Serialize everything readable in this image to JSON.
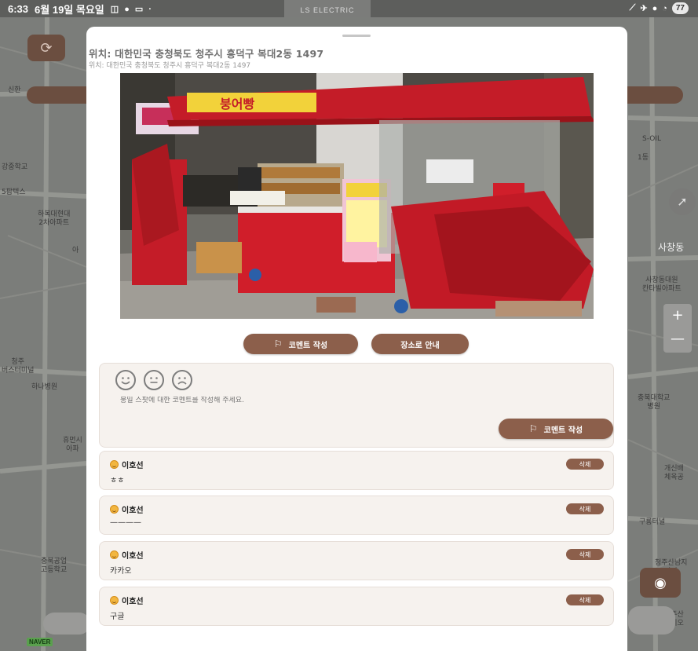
{
  "status_bar": {
    "time": "6:33",
    "date": "6월 19일 목요일",
    "battery": "77",
    "sign_text": "LS ELECTRIC"
  },
  "map": {
    "labels": [
      {
        "text": "신한",
        "id": "l1"
      },
      {
        "text": "강중학교",
        "id": "l2"
      },
      {
        "text": "5팝텍스",
        "id": "l3"
      },
      {
        "text": "하복대현대\n2차아파트",
        "id": "l4"
      },
      {
        "text": "아",
        "id": "l5"
      },
      {
        "text": "청주\n버스터미널",
        "id": "l6"
      },
      {
        "text": "하나병원",
        "id": "l7"
      },
      {
        "text": "휴먼시\n아파",
        "id": "l8"
      },
      {
        "text": "충북공업\n고등학교",
        "id": "l9"
      },
      {
        "text": "S-OIL",
        "id": "r1"
      },
      {
        "text": "1동",
        "id": "r2"
      },
      {
        "text": "사창동",
        "id": "r3"
      },
      {
        "text": "사창동대원\n칸타빌아파트",
        "id": "r4"
      },
      {
        "text": "충북대학교\n병원",
        "id": "r5"
      },
      {
        "text": "개신배\n체육공",
        "id": "r6"
      },
      {
        "text": "구룡터널",
        "id": "r7"
      },
      {
        "text": "청주산남지\n아파",
        "id": "r8"
      },
      {
        "text": "정주산\n르지오",
        "id": "r9"
      }
    ],
    "naver_logo": "NAVER",
    "zoom_in": "+",
    "zoom_out": "—"
  },
  "sheet": {
    "location_title": "위치: 대한민국 충청북도 청주시 흥덕구 복대2동 1497",
    "location_sub": "위치: 대한민국 충청북도 청주시 흥덕구 복대2동 1497",
    "photo_sign": "붕어빵",
    "write_comment_label": "코멘트 작성",
    "navigate_label": "장소로 안내",
    "comment_placeholder": "붕일 스팟에 대한 코멘트를 작성해 주세요.",
    "submit_comment_label": "코멘트 작성",
    "delete_label": "삭제",
    "comments": [
      {
        "author": "이호선",
        "text": "ㅎㅎ"
      },
      {
        "author": "이호선",
        "text": "————"
      },
      {
        "author": "이호선",
        "text": "카카오"
      },
      {
        "author": "이호선",
        "text": "구글"
      }
    ]
  },
  "colors": {
    "accent_brown": "#8c5f4b",
    "card_bg": "#f6f2ee",
    "tent_red": "#c81e28"
  }
}
